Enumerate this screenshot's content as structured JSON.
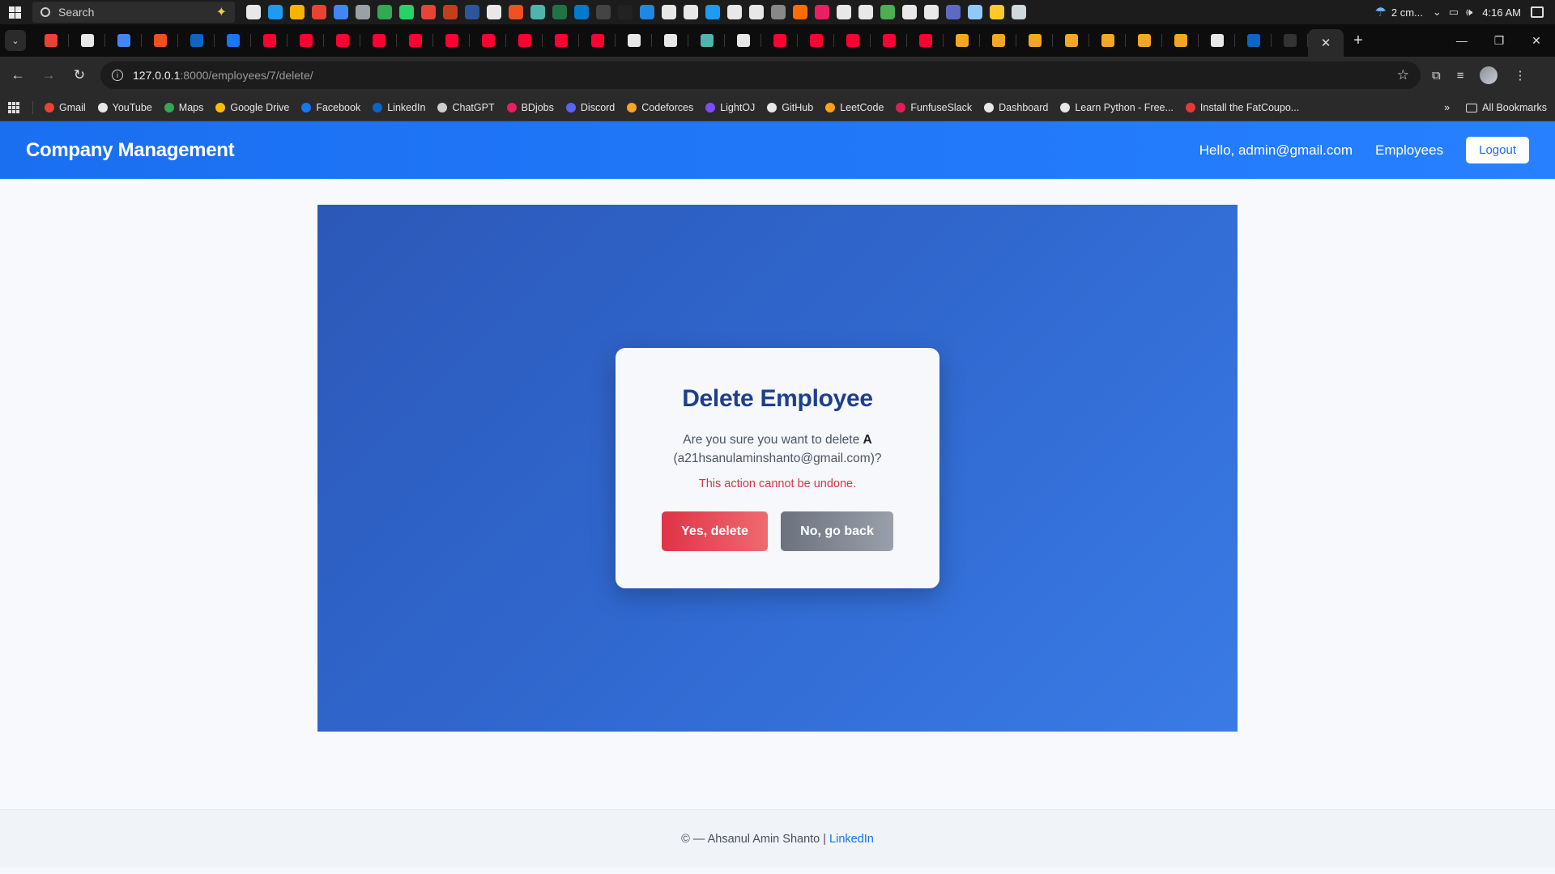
{
  "taskbar": {
    "search_placeholder": "Search",
    "weather_text": "2 cm...",
    "time": "4:16 AM",
    "app_colors": [
      "#e8e8e8",
      "#1b9cf2",
      "#f4b400",
      "#ea4335",
      "#4285f4",
      "#9aa0a6",
      "#34a853",
      "#25d366",
      "#ea4335",
      "#c43e1c",
      "#2b579a",
      "#e8e8e8",
      "#f25022",
      "#4db6ac",
      "#217346",
      "#007acc",
      "#444",
      "#222",
      "#1e88e5",
      "#e8e8e8",
      "#e8e8e8",
      "#1b9cf2",
      "#e8e8e8",
      "#e8e8e8",
      "#888",
      "#ff6d00",
      "#e91e63",
      "#e8e8e8",
      "#e8e8e8",
      "#4caf50",
      "#e8e8e8",
      "#e8e8e8",
      "#5c6bc0",
      "#90caf9",
      "#ffca28",
      "#cfd8dc"
    ]
  },
  "browser": {
    "tab_favicon_colors": [
      "#ea4335",
      "#e8e8e8",
      "#4285f4",
      "#f24e1e",
      "#0a66c2",
      "#1877f2",
      "#ff0033",
      "#ff0033",
      "#ff0033",
      "#ff0033",
      "#ff0033",
      "#ff0033",
      "#ff0033",
      "#ff0033",
      "#ff0033",
      "#ff0033",
      "#e8e8e8",
      "#e8e8e8",
      "#4db6ac",
      "#e8e8e8",
      "#ff0033",
      "#ff0033",
      "#ff0033",
      "#ff0033",
      "#ff0033",
      "#f5a623",
      "#f5a623",
      "#f5a623",
      "#f5a623",
      "#f5a623",
      "#f5a623",
      "#f5a623",
      "#e8e8e8",
      "#0a66c2",
      "#333"
    ],
    "active_tab_close": "✕",
    "new_tab": "+",
    "url_host": "127.0.0.1",
    "url_path": ":8000/employees/7/delete/",
    "bookmarks": [
      {
        "label": "Gmail",
        "color": "#ea4335"
      },
      {
        "label": "YouTube",
        "color": "#e8e8e8"
      },
      {
        "label": "Maps",
        "color": "#34a853"
      },
      {
        "label": "Google Drive",
        "color": "#fbbc04"
      },
      {
        "label": "Facebook",
        "color": "#1877f2"
      },
      {
        "label": "LinkedIn",
        "color": "#0a66c2"
      },
      {
        "label": "ChatGPT",
        "color": "#cfcfcf"
      },
      {
        "label": "BDjobs",
        "color": "#e91e63"
      },
      {
        "label": "Discord",
        "color": "#5865f2"
      },
      {
        "label": "Codeforces",
        "color": "#f5a623"
      },
      {
        "label": "LightOJ",
        "color": "#7c4dff"
      },
      {
        "label": "GitHub",
        "color": "#e8e8e8"
      },
      {
        "label": "LeetCode",
        "color": "#ffa116"
      },
      {
        "label": "FunfuseSlack",
        "color": "#e01e5a"
      },
      {
        "label": "Dashboard",
        "color": "#e8e8e8"
      },
      {
        "label": "Learn Python - Free...",
        "color": "#e8e8e8"
      },
      {
        "label": "Install the FatCoupo...",
        "color": "#e53935"
      }
    ],
    "more_bookmarks": "»",
    "all_bookmarks": "All Bookmarks"
  },
  "app": {
    "brand": "Company Management",
    "greeting": "Hello, admin@gmail.com",
    "nav_employees": "Employees",
    "logout": "Logout",
    "card": {
      "title": "Delete Employee",
      "msg_prefix": "Are you sure you want to delete ",
      "employee_name": "A",
      "employee_email": "(a21hsanulaminshanto@gmail.com)?",
      "warning": "This action cannot be undone.",
      "confirm_label": "Yes, delete",
      "cancel_label": "No, go back"
    },
    "footer": {
      "text": "© — Ahsanul Amin Shanto |",
      "link_label": "LinkedIn"
    },
    "colors": {
      "nav_blue": "#1a6ff1",
      "title_blue": "#1f3f8c",
      "danger": "#d63447",
      "delete_btn": "#df3348",
      "back_btn": "#6b727e"
    }
  }
}
